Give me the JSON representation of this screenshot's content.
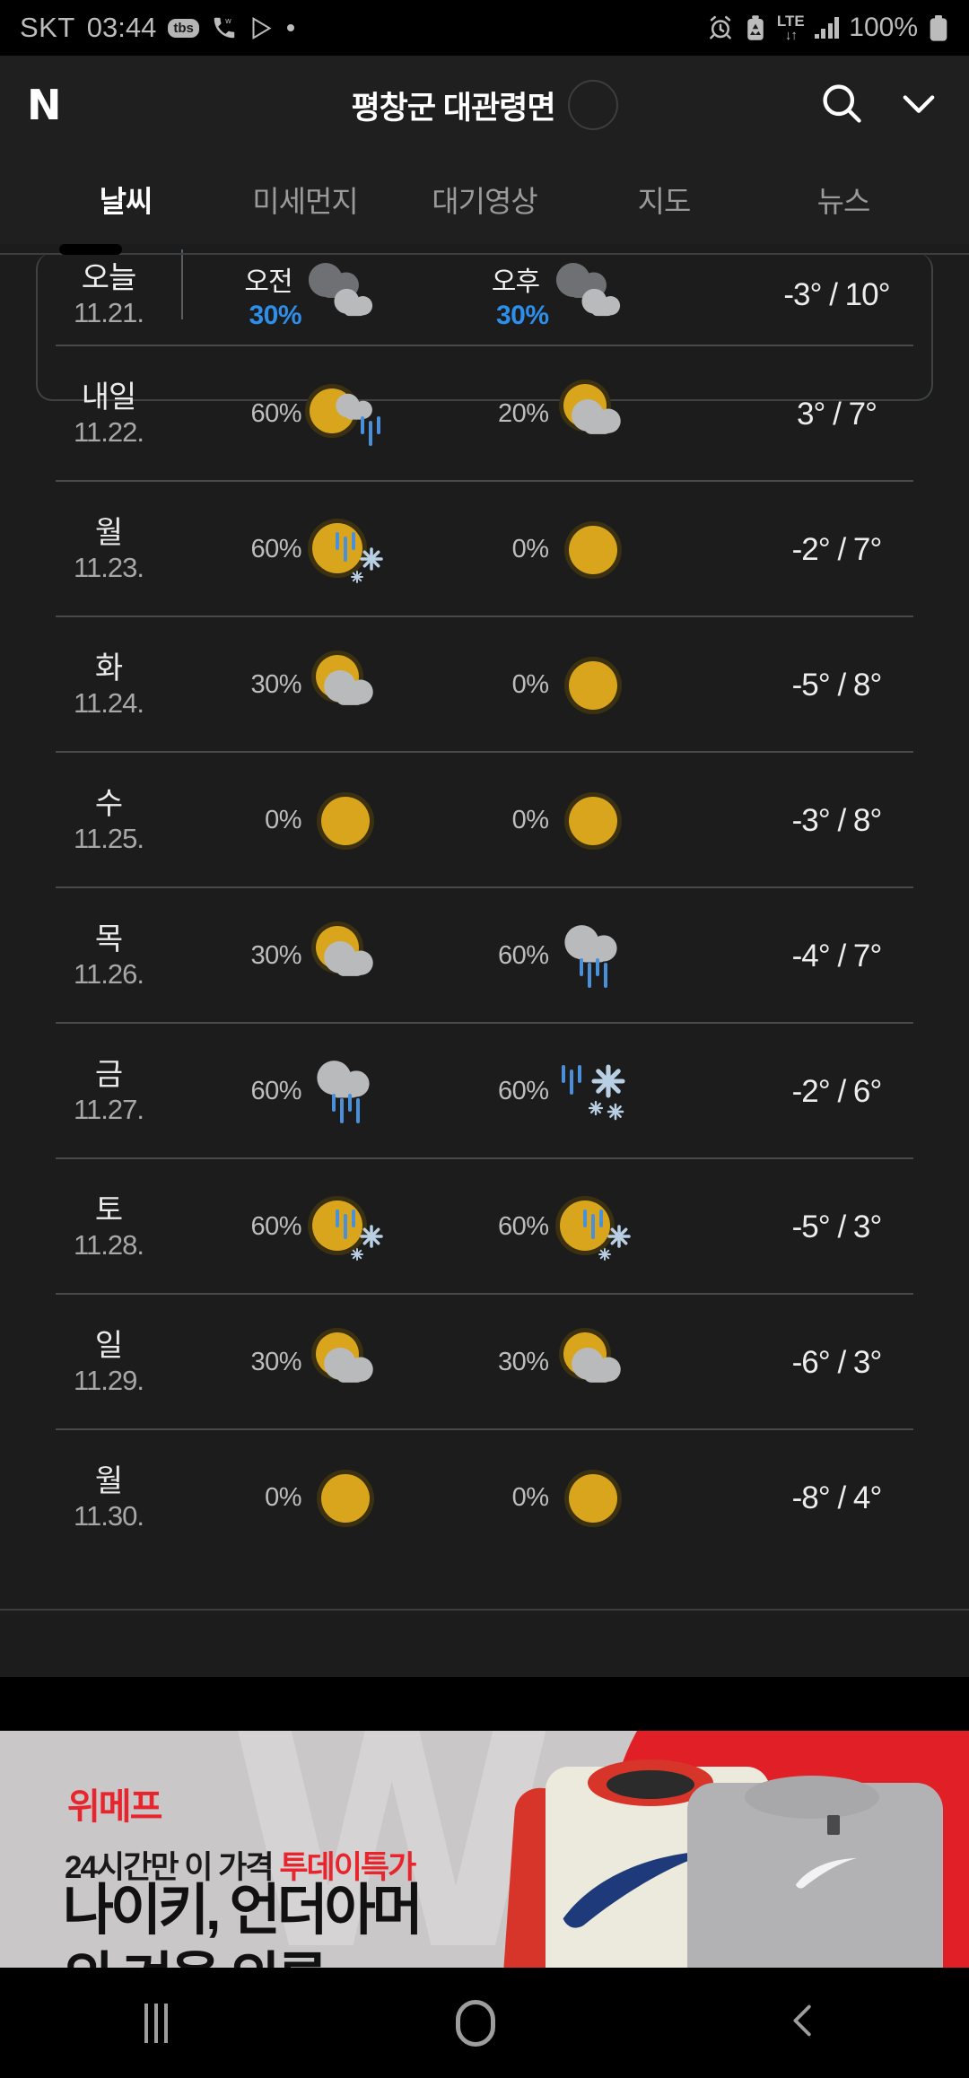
{
  "statusbar": {
    "carrier": "SKT",
    "time": "03:44",
    "app_icons": [
      "tbs-icon",
      "whowho-icon",
      "play-store-icon",
      "dot-icon"
    ],
    "right_icons": [
      "alarm-icon",
      "battery-saver-icon",
      "lte-icon",
      "signal-icon",
      "battery-icon"
    ],
    "lte_label": "LTE",
    "lte_arrows": "↓↑",
    "battery_percent": "100%"
  },
  "header": {
    "logo": "N",
    "location_title": "평창군 대관령면",
    "spinner": "loading-spinner",
    "search_icon": "search-icon",
    "expand_icon": "chevron-down-icon"
  },
  "tabs": [
    {
      "label": "날씨",
      "active": true
    },
    {
      "label": "미세먼지",
      "active": false
    },
    {
      "label": "대기영상",
      "active": false
    },
    {
      "label": "지도",
      "active": false
    },
    {
      "label": "뉴스",
      "active": false
    }
  ],
  "forecast": {
    "am_label": "오전",
    "pm_label": "오후",
    "days": [
      {
        "name": "오늘",
        "date": "11.21.",
        "today": true,
        "am": {
          "pop": "30%",
          "icon": "cloudy-icon"
        },
        "pm": {
          "pop": "30%",
          "icon": "cloudy-icon"
        },
        "temps": "-3° / 10°"
      },
      {
        "name": "내일",
        "date": "11.22.",
        "today": false,
        "am": {
          "pop": "60%",
          "icon": "sun-cloud-rain-icon"
        },
        "pm": {
          "pop": "20%",
          "icon": "sun-cloud-icon"
        },
        "temps": "3° / 7°"
      },
      {
        "name": "월",
        "date": "11.23.",
        "today": false,
        "am": {
          "pop": "60%",
          "icon": "sun-rain-snow-icon"
        },
        "pm": {
          "pop": "0%",
          "icon": "sun-icon"
        },
        "temps": "-2° / 7°"
      },
      {
        "name": "화",
        "date": "11.24.",
        "today": false,
        "am": {
          "pop": "30%",
          "icon": "sun-cloud-icon"
        },
        "pm": {
          "pop": "0%",
          "icon": "sun-icon"
        },
        "temps": "-5° / 8°"
      },
      {
        "name": "수",
        "date": "11.25.",
        "today": false,
        "am": {
          "pop": "0%",
          "icon": "sun-icon"
        },
        "pm": {
          "pop": "0%",
          "icon": "sun-icon"
        },
        "temps": "-3° / 8°"
      },
      {
        "name": "목",
        "date": "11.26.",
        "today": false,
        "am": {
          "pop": "30%",
          "icon": "sun-cloud-icon"
        },
        "pm": {
          "pop": "60%",
          "icon": "rain-icon"
        },
        "temps": "-4° / 7°"
      },
      {
        "name": "금",
        "date": "11.27.",
        "today": false,
        "am": {
          "pop": "60%",
          "icon": "rain-icon"
        },
        "pm": {
          "pop": "60%",
          "icon": "rain-snow-icon"
        },
        "temps": "-2° / 6°"
      },
      {
        "name": "토",
        "date": "11.28.",
        "today": false,
        "am": {
          "pop": "60%",
          "icon": "sun-rain-snow-icon"
        },
        "pm": {
          "pop": "60%",
          "icon": "sun-rain-snow-icon"
        },
        "temps": "-5° / 3°"
      },
      {
        "name": "일",
        "date": "11.29.",
        "today": false,
        "am": {
          "pop": "30%",
          "icon": "sun-cloud-icon"
        },
        "pm": {
          "pop": "30%",
          "icon": "sun-cloud-icon"
        },
        "temps": "-6° / 3°"
      },
      {
        "name": "월",
        "date": "11.30.",
        "today": false,
        "am": {
          "pop": "0%",
          "icon": "sun-icon"
        },
        "pm": {
          "pop": "0%",
          "icon": "sun-icon"
        },
        "temps": "-8° / 4°"
      }
    ]
  },
  "ad": {
    "brand": "위메프",
    "watermark": "W",
    "subline_plain": "24시간만 이 가격 ",
    "subline_highlight": "투데이특가",
    "headline": "나이키, 언더아머",
    "headline2": "외 겨울 의류"
  },
  "navbar": {
    "recents": "recents-icon",
    "home": "home-icon",
    "back": "back-icon"
  },
  "colors": {
    "accent_blue": "#2e8fea",
    "sun_yellow": "#d9a51c",
    "ad_red": "#e8252c",
    "bg": "#1c1c1c",
    "header_bg": "#1f1f1f"
  }
}
